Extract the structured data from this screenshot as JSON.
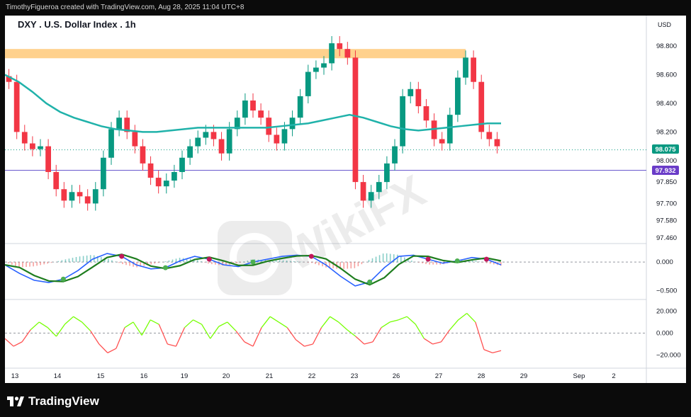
{
  "header": {
    "caption": "TimothyFigueroa created with TradingView.com, Aug 28, 2025 11:04 UTC+8"
  },
  "chart": {
    "title": "DXY . U.S. Dollar Index . 1h",
    "currency": "USD"
  },
  "price_labels": {
    "last": "98.075",
    "line": "97.932"
  },
  "footer": {
    "brand": "TradingView"
  },
  "watermark": {
    "text": "WikiFX"
  },
  "colors": {
    "up": "#089981",
    "down": "#f23645",
    "ma": "#20b2aa",
    "zone": "#ffcc80",
    "hline": "#6a5acd",
    "macd": "#2962ff",
    "signal": "#c2185b",
    "osc_up": "#76ff03",
    "osc_down": "#ff5252"
  },
  "chart_data": {
    "type": "line",
    "price_axis": {
      "ticks": [
        98.8,
        98.6,
        98.4,
        98.2,
        98.0,
        97.85,
        97.7,
        97.58,
        97.46
      ],
      "labels": [
        "98.800",
        "98.600",
        "98.400",
        "98.200",
        "98.000",
        "97.850",
        "97.700",
        "97.580",
        "97.460"
      ]
    },
    "macd_axis": {
      "ticks": [
        0.0,
        -0.5
      ],
      "labels": [
        "0.000",
        "−0.500"
      ]
    },
    "osc_axis": {
      "ticks": [
        20,
        0,
        -20
      ],
      "labels": [
        "20.000",
        "0.000",
        "−20.000"
      ]
    },
    "x_ticks": [
      "13",
      "14",
      "15",
      "16",
      "19",
      "20",
      "21",
      "22",
      "23",
      "26",
      "27",
      "28",
      "29",
      "Sep",
      "2"
    ],
    "series": [
      {
        "name": "",
        "kind": "candles_close",
        "values": [
          98.55,
          98.2,
          98.12,
          98.08,
          98.1,
          97.92,
          97.8,
          97.72,
          97.78,
          97.75,
          97.7,
          97.8,
          98.02,
          98.22,
          98.3,
          98.2,
          98.1,
          97.98,
          97.88,
          97.82,
          97.86,
          97.92,
          98.02,
          98.1,
          98.16,
          98.2,
          98.15,
          98.05,
          98.22,
          98.3,
          98.42,
          98.35,
          98.3,
          98.18,
          98.12,
          98.22,
          98.3,
          98.45,
          98.62,
          98.65,
          98.68,
          98.82,
          98.78,
          98.72,
          97.85,
          97.72,
          97.78,
          97.85,
          97.98,
          98.1,
          98.45,
          98.5,
          98.38,
          98.28,
          98.15,
          98.12,
          98.32,
          98.58,
          98.72,
          98.55,
          98.2,
          98.15,
          98.1
        ]
      },
      {
        "name": "",
        "kind": "moving_average",
        "values": [
          98.6,
          98.55,
          98.48,
          98.4,
          98.34,
          98.3,
          98.27,
          98.24,
          98.22,
          98.21,
          98.2,
          98.2,
          98.21,
          98.22,
          98.23,
          98.23,
          98.23,
          98.23,
          98.23,
          98.23,
          98.24,
          98.25,
          98.26,
          98.28,
          98.3,
          98.32,
          98.3,
          98.27,
          98.24,
          98.22,
          98.21,
          98.22,
          98.23,
          98.24,
          98.25,
          98.26,
          98.26
        ]
      },
      {
        "name": "",
        "kind": "macd",
        "values": [
          -0.05,
          -0.2,
          -0.32,
          -0.36,
          -0.3,
          -0.15,
          0.05,
          0.15,
          0.1,
          -0.05,
          -0.12,
          -0.1,
          0.02,
          0.1,
          0.05,
          -0.05,
          -0.08,
          0.0,
          0.05,
          0.1,
          0.12,
          0.1,
          -0.05,
          -0.25,
          -0.42,
          -0.35,
          -0.1,
          0.1,
          0.12,
          0.05,
          -0.02,
          0.02,
          0.08,
          0.05,
          -0.05
        ]
      },
      {
        "name": "",
        "kind": "oscillator",
        "values": [
          -5,
          -12,
          -8,
          3,
          10,
          5,
          -3,
          8,
          15,
          10,
          2,
          -10,
          -18,
          -14,
          5,
          10,
          -2,
          12,
          8,
          -10,
          -12,
          5,
          12,
          8,
          -5,
          6,
          10,
          2,
          -8,
          -12,
          5,
          15,
          10,
          5,
          -6,
          -12,
          -10,
          5,
          15,
          10,
          3,
          -3,
          -10,
          -8,
          5,
          10,
          12,
          15,
          8,
          -5,
          -10,
          -8,
          3,
          12,
          18,
          10,
          -15,
          -18,
          -16
        ]
      }
    ]
  }
}
